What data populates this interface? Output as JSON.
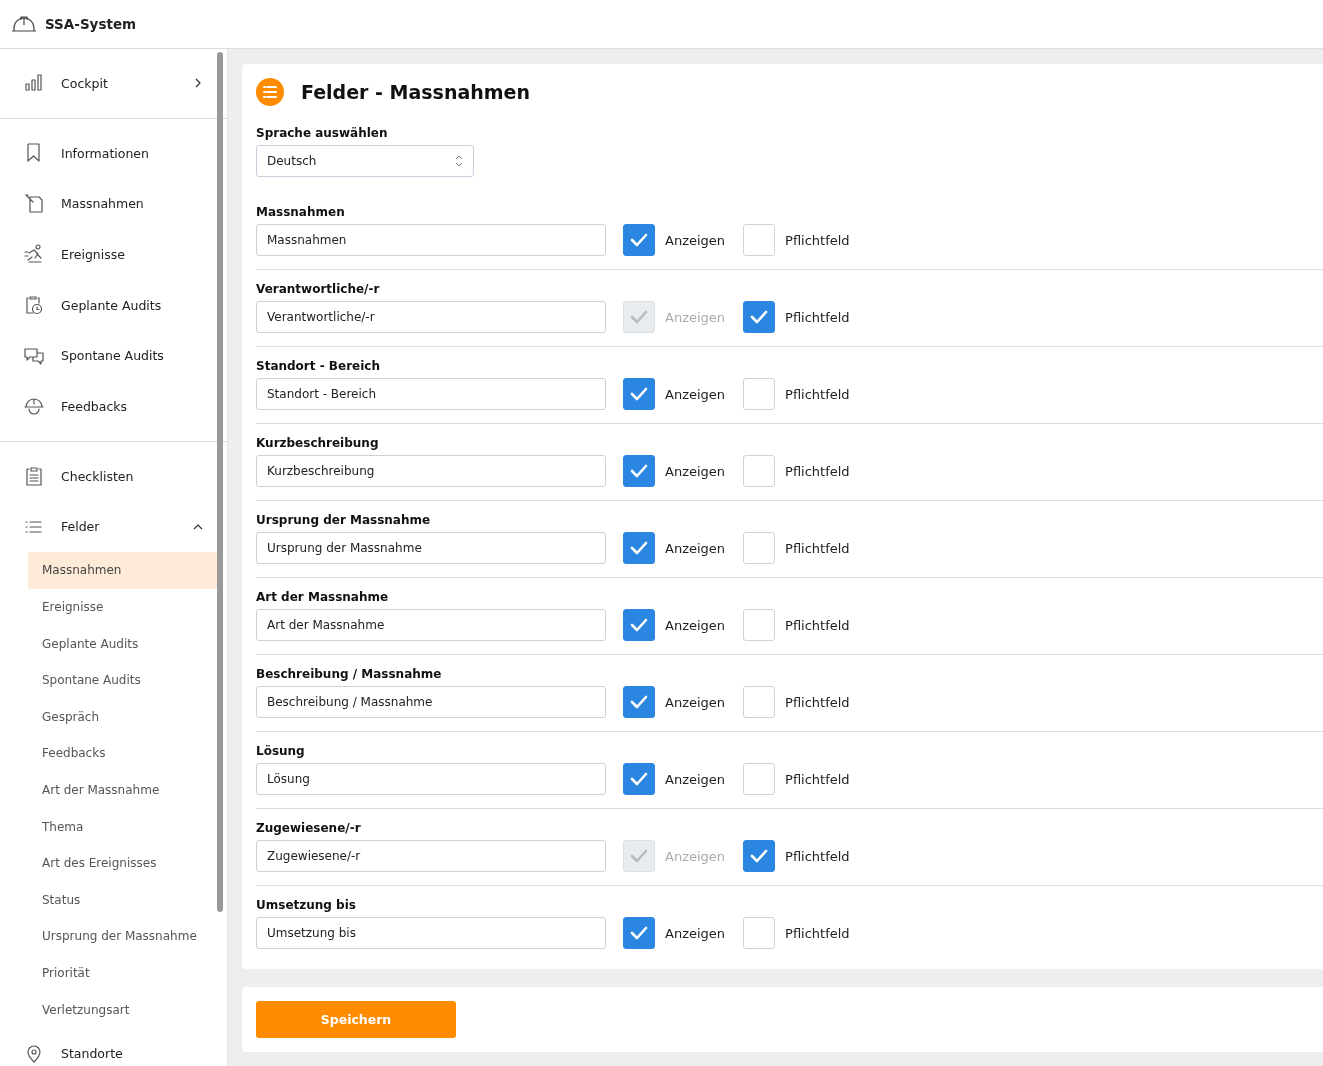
{
  "app": {
    "title": "SSA-System"
  },
  "sidebar": {
    "sections": [
      {
        "items": [
          {
            "label": "Cockpit",
            "expanded": false
          }
        ]
      },
      {
        "items": [
          {
            "label": "Informationen"
          },
          {
            "label": "Massnahmen"
          },
          {
            "label": "Ereignisse"
          },
          {
            "label": "Geplante Audits"
          },
          {
            "label": "Spontane Audits"
          },
          {
            "label": "Feedbacks"
          }
        ]
      },
      {
        "items": [
          {
            "label": "Checklisten"
          },
          {
            "label": "Felder",
            "expanded": true,
            "children": [
              {
                "label": "Massnahmen",
                "selected": true
              },
              {
                "label": "Ereignisse",
                "selected": false
              },
              {
                "label": "Geplante Audits",
                "selected": false
              },
              {
                "label": "Spontane Audits",
                "selected": false
              },
              {
                "label": "Gespräch",
                "selected": false
              },
              {
                "label": "Feedbacks",
                "selected": false
              },
              {
                "label": "Art der Massnahme",
                "selected": false
              },
              {
                "label": "Thema",
                "selected": false
              },
              {
                "label": "Art des Ereignisses",
                "selected": false
              },
              {
                "label": "Status",
                "selected": false
              },
              {
                "label": "Ursprung der Massnahme",
                "selected": false
              },
              {
                "label": "Priorität",
                "selected": false
              },
              {
                "label": "Verletzungsart",
                "selected": false
              }
            ]
          },
          {
            "label": "Standorte"
          }
        ]
      }
    ]
  },
  "page": {
    "title": "Felder - Massnahmen",
    "language": {
      "label": "Sprache auswählen",
      "value": "Deutsch"
    },
    "fields": [
      {
        "label": "Massnahmen",
        "value": "Massnahmen",
        "show": {
          "label": "Anzeigen",
          "checked": true,
          "disabled": false
        },
        "required": {
          "label": "Pflichtfeld",
          "checked": false
        }
      },
      {
        "label": "Verantwortliche/-r",
        "value": "Verantwortliche/-r",
        "show": {
          "label": "Anzeigen",
          "checked": true,
          "disabled": true
        },
        "required": {
          "label": "Pflichtfeld",
          "checked": true
        }
      },
      {
        "label": "Standort - Bereich",
        "value": "Standort - Bereich",
        "show": {
          "label": "Anzeigen",
          "checked": true,
          "disabled": false
        },
        "required": {
          "label": "Pflichtfeld",
          "checked": false
        }
      },
      {
        "label": "Kurzbeschreibung",
        "value": "Kurzbeschreibung",
        "show": {
          "label": "Anzeigen",
          "checked": true,
          "disabled": false
        },
        "required": {
          "label": "Pflichtfeld",
          "checked": false
        }
      },
      {
        "label": "Ursprung der Massnahme",
        "value": "Ursprung der Massnahme",
        "show": {
          "label": "Anzeigen",
          "checked": true,
          "disabled": false
        },
        "required": {
          "label": "Pflichtfeld",
          "checked": false
        }
      },
      {
        "label": "Art der Massnahme",
        "value": "Art der Massnahme",
        "show": {
          "label": "Anzeigen",
          "checked": true,
          "disabled": false
        },
        "required": {
          "label": "Pflichtfeld",
          "checked": false
        }
      },
      {
        "label": "Beschreibung / Massnahme",
        "value": "Beschreibung / Massnahme",
        "show": {
          "label": "Anzeigen",
          "checked": true,
          "disabled": false
        },
        "required": {
          "label": "Pflichtfeld",
          "checked": false
        }
      },
      {
        "label": "Lösung",
        "value": "Lösung",
        "show": {
          "label": "Anzeigen",
          "checked": true,
          "disabled": false
        },
        "required": {
          "label": "Pflichtfeld",
          "checked": false
        }
      },
      {
        "label": "Zugewiesene/-r",
        "value": "Zugewiesene/-r",
        "show": {
          "label": "Anzeigen",
          "checked": true,
          "disabled": true
        },
        "required": {
          "label": "Pflichtfeld",
          "checked": true
        }
      },
      {
        "label": "Umsetzung bis",
        "value": "Umsetzung bis",
        "show": {
          "label": "Anzeigen",
          "checked": true,
          "disabled": false
        },
        "required": {
          "label": "Pflichtfeld",
          "checked": false
        }
      }
    ],
    "save_button": "Speichern"
  }
}
